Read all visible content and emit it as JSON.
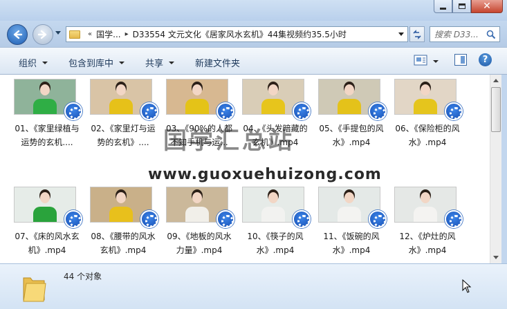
{
  "window": {
    "minimize_icon": "minimize-icon",
    "maximize_icon": "maximize-icon",
    "close_icon": "close-icon"
  },
  "address_bar": {
    "crumb_root": "国学...",
    "current_folder": "D33554 文元文化《居家风水玄机》44集视频约35.5小时",
    "search_placeholder": "搜索 D33..."
  },
  "toolbar": {
    "organize": "组织",
    "include_in_library": "包含到库中",
    "share": "共享",
    "new_folder": "新建文件夹"
  },
  "files": [
    {
      "name": "01、《家里绿植与运势的玄机....",
      "bg": "#8fb39a",
      "body": "#2fae45"
    },
    {
      "name": "02、《家里灯与运势的玄机》....",
      "bg": "#d9c4a6",
      "body": "#e6c119"
    },
    {
      "name": "03、《90%的人都不知手机与运...",
      "bg": "#d7b891",
      "body": "#e4c318"
    },
    {
      "name": "04、《头发暗藏的玄机》.mp4",
      "bg": "#d9cdb7",
      "body": "#e7c51c"
    },
    {
      "name": "05、《手提包的风水》.mp4",
      "bg": "#cfc9b6",
      "body": "#e4c21a"
    },
    {
      "name": "06、《保险柜的风水》.mp4",
      "bg": "#e2d6c6",
      "body": "#e5c51d"
    },
    {
      "name": "07、《床的风水玄机》.mp4",
      "bg": "#e6ece8",
      "body": "#2aa33c"
    },
    {
      "name": "08、《腰带的风水玄机》.mp4",
      "bg": "#c9b089",
      "body": "#e8c01c"
    },
    {
      "name": "09、《地板的风水力量》.mp4",
      "bg": "#cbb89a",
      "body": "#f1efe9"
    },
    {
      "name": "10、《筷子的风水》.mp4",
      "bg": "#e6ebe8",
      "body": "#f2f2f0"
    },
    {
      "name": "11、《饭碗的风水》.mp4",
      "bg": "#e4e9e7",
      "body": "#f3f3f1"
    },
    {
      "name": "12、《炉灶的风水》.mp4",
      "bg": "#e5e8e6",
      "body": "#f4f3f1"
    }
  ],
  "watermark": {
    "title": "国学汇总站",
    "url": "www.guoxuehuizong.com"
  },
  "status": {
    "item_count": "44 个对象"
  }
}
